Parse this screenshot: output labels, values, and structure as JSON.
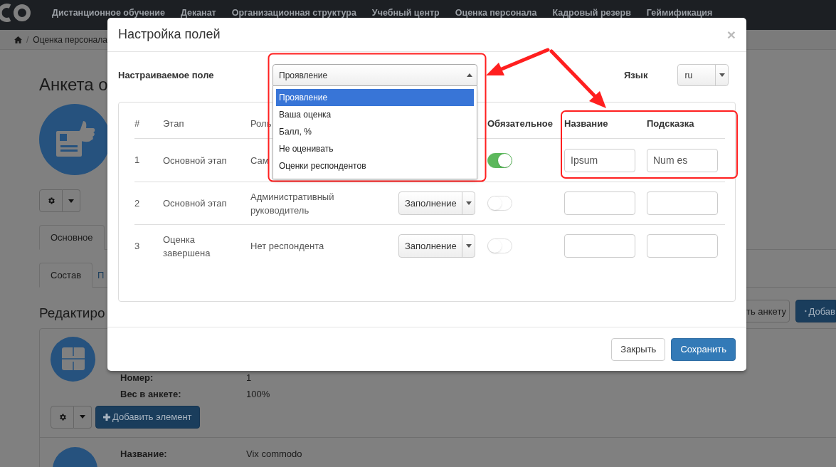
{
  "nav": {
    "items": [
      "Дистанционное обучение",
      "Деканат",
      "Организационная структура",
      "Учебный центр",
      "Оценка персонала",
      "Кадровый резерв",
      "Геймификация"
    ]
  },
  "breadcrumb": {
    "separator": "/",
    "items": [
      "Оценка персонала"
    ]
  },
  "page": {
    "title": "Анкета о",
    "tabs": [
      {
        "label": "Основное",
        "selected": true
      }
    ],
    "subtabs": [
      {
        "label": "Состав",
        "selected": true
      },
      {
        "label": "П",
        "selected": false
      }
    ],
    "section_title": "Редактиро",
    "header_buttons": [
      {
        "label": "ть анкету",
        "kind": "default"
      },
      {
        "label": "Добав",
        "kind": "primary"
      }
    ],
    "element": {
      "fields": [
        {
          "label": "Номер:",
          "value": "1"
        },
        {
          "label": "Вес в анкете:",
          "value": "100%"
        }
      ],
      "add_button": "Добавить элемент"
    },
    "next_element": {
      "fields": [
        {
          "label": "Название:",
          "value": "Vix commodo"
        }
      ]
    }
  },
  "modal": {
    "title": "Настройка полей",
    "close": "×",
    "field_label": "Настраиваемое поле",
    "field_select": {
      "value": "Проявление",
      "expanded": true,
      "options": [
        {
          "label": "Проявление",
          "selected": true
        },
        {
          "label": "Ваша оценка",
          "selected": false
        },
        {
          "label": "Балл, %",
          "selected": false
        },
        {
          "label": "Не оценивать",
          "selected": false
        },
        {
          "label": "Оценки респондентов",
          "selected": false
        }
      ]
    },
    "language_label": "Язык",
    "language_select": {
      "value": "ru"
    },
    "table": {
      "columns": [
        "#",
        "Этап",
        "Роль",
        "Обязательное",
        "Название",
        "Подсказка"
      ],
      "rows": [
        {
          "number": "1",
          "stage": "Основной этап",
          "role": "Сам",
          "required": true,
          "name": {
            "value": "Ipsum"
          },
          "hint": {
            "value": "Num es"
          }
        },
        {
          "number": "2",
          "stage": "Основной этап",
          "role": "Административный руководитель",
          "mode": "Заполнение",
          "required": false
        },
        {
          "number": "3",
          "stage": "Оценка завершена",
          "role": "Нет респондента",
          "mode": "Заполнение",
          "required": false
        }
      ]
    },
    "buttons": [
      {
        "label": "Закрыть",
        "kind": "default"
      },
      {
        "label": "Сохранить",
        "kind": "primary"
      }
    ]
  }
}
